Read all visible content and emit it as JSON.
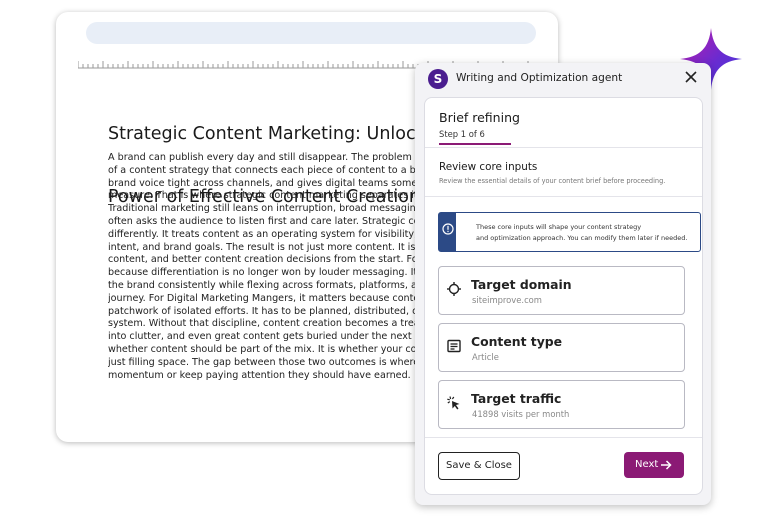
{
  "document": {
    "title_lines": [
      "Strategic Content Marketing: Unlocking the",
      "Power of Effective Content Creation"
    ],
    "body_lines": [
      "A brand can publish every day and still disappear. The problem is not volume. It is the absence",
      "of a content strategy that connects each piece of content to a business goal",
      "brand voice tight across channels, and gives digital teams something sharp to",
      "measure. That is where strategic content marketing separates itself from noise.",
      "Traditional marketing still leans on interruption, broad messaging, and a",
      "often asks the audience to listen first and care later. Strategic content marketing works",
      "differently. It treats content as an operating system for visibility, trust and",
      "intent, and brand goals. The result is not just more content. It is useful content,",
      "content, and better content creation decisions from the start. For Brand",
      "because differentiation is no longer won by louder messaging. It is won by",
      "the brand consistently while flexing across formats, platforms, and moments",
      "journey. For Digital Marketing Mangers, it matters because content marketing",
      "patchwork of isolated efforts. It has to be planned, distributed, optimized",
      "system. Without that discipline, content creation becomes a treadmill, output",
      "into clutter, and even great content gets buried under the next deadline.",
      "whether content should be part of the mix. It is whether your content is",
      "just filling space. The gap between those two outcomes is where brands",
      "momentum or keep paying attention they should have earned."
    ]
  },
  "agent": {
    "avatar_letter": "S",
    "title": "Writing and Optimization agent",
    "step_title": "Brief refining",
    "step_label": "Step 1 of 6",
    "review_title": "Review core inputs",
    "review_subtitle": "Review the essential details of your content brief before proceeding.",
    "info_line1": "These core inputs will shape your content strategy",
    "info_line2": "and optimization approach. You can modify them later if needed.",
    "cards": [
      {
        "title": "Target domain",
        "value": "siteimprove.com",
        "icon": "crosshair-icon"
      },
      {
        "title": "Content type",
        "value": "Article",
        "icon": "article-icon"
      },
      {
        "title": "Target traffic",
        "value": "41898 visits per month",
        "icon": "cursor-click-icon"
      }
    ],
    "save_label": "Save & Close",
    "next_label": "Next"
  },
  "colors": {
    "accent": "#8b1a75",
    "avatar": "#4a1d8f",
    "info": "#2c4a86"
  }
}
